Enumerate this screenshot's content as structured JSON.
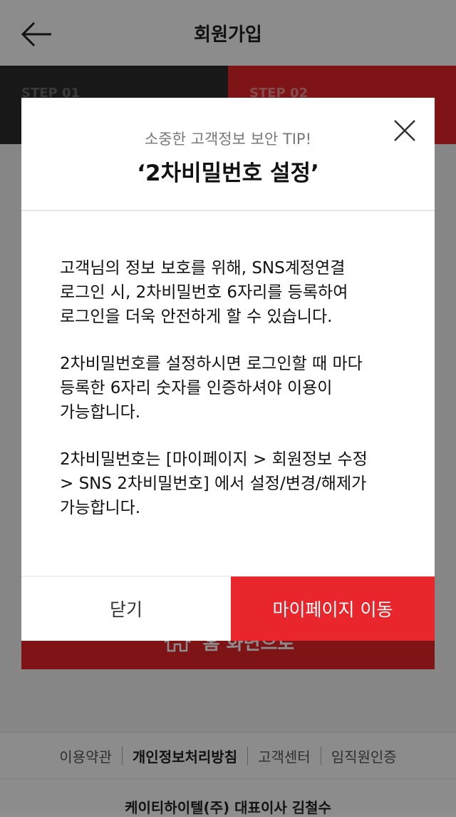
{
  "header": {
    "title": "회원가입"
  },
  "steps": [
    {
      "label": "STEP 01"
    },
    {
      "label": "STEP 02"
    }
  ],
  "home_button": {
    "label": "홈 화면으로"
  },
  "footer": {
    "links": [
      "이용약관",
      "개인정보처리방침",
      "고객센터",
      "임직원인증"
    ],
    "company": "케이티하이텔(주) 대표이사 김철수"
  },
  "modal": {
    "subtitle": "소중한 고객정보 보안 TIP!",
    "title": "‘2차비밀번호 설정’",
    "paragraphs": [
      [
        "고객님의 정보 보호를 위해, SNS계정연결",
        "로그인 시, 2차비밀번호 6자리를 등록하여",
        "로그인을 더욱 안전하게 할 수 있습니다."
      ],
      [
        "2차비밀번호를 설정하시면 로그인할 때 마다",
        "등록한 6자리 숫자를 인증하셔야 이용이",
        "가능합니다."
      ],
      [
        "2차비밀번호는 [마이페이지 > 회원정보 수정",
        "> SNS 2차비밀번호] 에서 설정/변경/해제가",
        "가능합니다."
      ]
    ],
    "close_label": "닫기",
    "mypage_label": "마이페이지 이동"
  },
  "colors": {
    "accent": "#e8262b",
    "dark": "#2d2d2d"
  },
  "icons": {
    "back": "arrow-left-icon",
    "close": "close-icon",
    "home": "home-icon"
  }
}
